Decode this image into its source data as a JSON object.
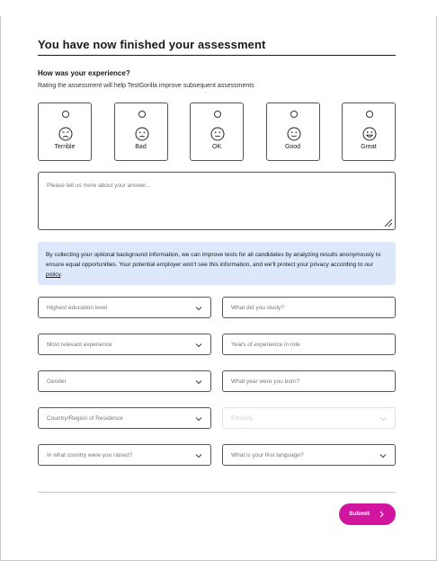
{
  "page": {
    "title": "You have now finished your assessment"
  },
  "experience": {
    "question": "How was your experience?",
    "subtitle": "Rating the assessment will help TestGorilla improve subsequent assessments",
    "options": [
      {
        "label": "Terrible",
        "icon": "very-sad-face-icon"
      },
      {
        "label": "Bad",
        "icon": "sad-face-icon"
      },
      {
        "label": "OK",
        "icon": "neutral-face-icon"
      },
      {
        "label": "Good",
        "icon": "smile-face-icon"
      },
      {
        "label": "Great",
        "icon": "big-smile-face-icon"
      }
    ]
  },
  "feedback": {
    "placeholder": "Please tell us more about your answer..."
  },
  "info": {
    "text": "By collecting your optional background information, we can improve tests for all candidates by analyzing results anonymously to ensure equal opportunities. Your potential employer won't see this information, and we'll protect your privacy according to our ",
    "link": "policy",
    "end": "."
  },
  "form": {
    "education": "Highest education level",
    "study": "What did you study?",
    "experience": "Most relevant experience",
    "years": "Years of experience in role",
    "gender": "Gender",
    "birth_year": "What year were you born?",
    "region": "Country/Region of Residence",
    "ethnicity": "Ethnicity",
    "raised": "In what country were you raised?",
    "language": "What is your first language?"
  },
  "submit": {
    "label": "Submit",
    "color": "#d1159e"
  },
  "colors": {
    "info_bg": "#dde8fc",
    "border": "#555555"
  }
}
